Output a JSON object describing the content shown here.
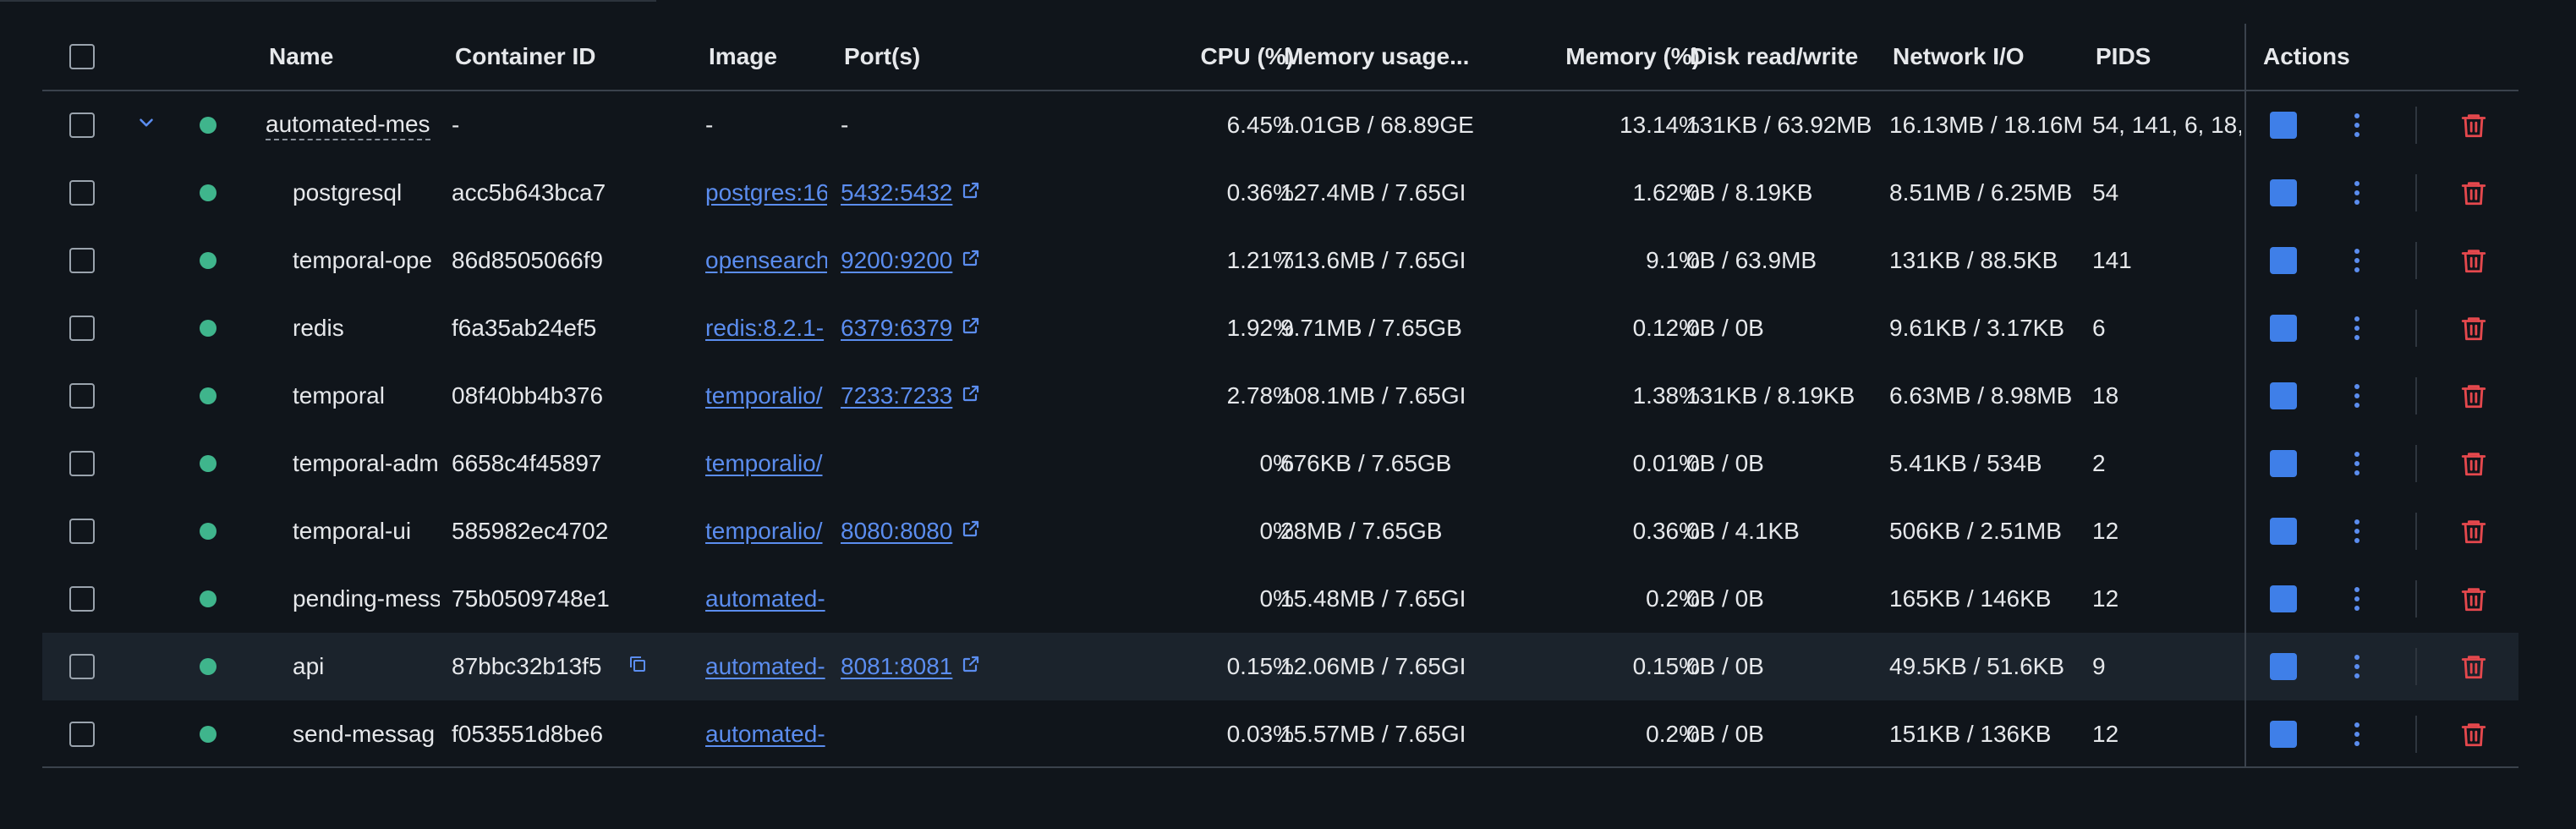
{
  "columns": {
    "name": "Name",
    "container_id": "Container ID",
    "image": "Image",
    "ports": "Port(s)",
    "cpu": "CPU (%)",
    "mem_usage": "Memory usage...",
    "mem_pct": "Memory (%)",
    "disk": "Disk read/write",
    "net": "Network I/O",
    "pids": "PIDS",
    "actions": "Actions"
  },
  "rows": [
    {
      "name": "automated-mes",
      "id": "-",
      "image": "-",
      "port": "-",
      "cpu": "6.45%",
      "mem": "1.01GB / 68.89GE",
      "memp": "13.14%",
      "disk": "131KB / 63.92MB",
      "net": "16.13MB / 18.16M",
      "pids": "54, 141, 6, 18,"
    },
    {
      "name": "postgresql",
      "id": "acc5b643bca7",
      "image": "postgres:16",
      "port": "5432:5432",
      "cpu": "0.36%",
      "mem": "127.4MB / 7.65GI",
      "memp": "1.62%",
      "disk": "0B / 8.19KB",
      "net": "8.51MB / 6.25MB",
      "pids": "54"
    },
    {
      "name": "temporal-ope",
      "id": "86d8505066f9",
      "image": "opensearch",
      "port": "9200:9200",
      "cpu": "1.21%",
      "mem": "713.6MB / 7.65GI",
      "memp": "9.1%",
      "disk": "0B / 63.9MB",
      "net": "131KB / 88.5KB",
      "pids": "141"
    },
    {
      "name": "redis",
      "id": "f6a35ab24ef5",
      "image": "redis:8.2.1-",
      "port": "6379:6379",
      "cpu": "1.92%",
      "mem": "9.71MB / 7.65GB",
      "memp": "0.12%",
      "disk": "0B / 0B",
      "net": "9.61KB / 3.17KB",
      "pids": "6"
    },
    {
      "name": "temporal",
      "id": "08f40bb4b376",
      "image": "temporalio/",
      "port": "7233:7233",
      "cpu": "2.78%",
      "mem": "108.1MB / 7.65GI",
      "memp": "1.38%",
      "disk": "131KB / 8.19KB",
      "net": "6.63MB / 8.98MB",
      "pids": "18"
    },
    {
      "name": "temporal-adm",
      "id": "6658c4f45897",
      "image": "temporalio/",
      "port": "",
      "cpu": "0%",
      "mem": "676KB / 7.65GB",
      "memp": "0.01%",
      "disk": "0B / 0B",
      "net": "5.41KB / 534B",
      "pids": "2"
    },
    {
      "name": "temporal-ui",
      "id": "585982ec4702",
      "image": "temporalio/",
      "port": "8080:8080",
      "cpu": "0%",
      "mem": "28MB / 7.65GB",
      "memp": "0.36%",
      "disk": "0B / 4.1KB",
      "net": "506KB / 2.51MB",
      "pids": "12"
    },
    {
      "name": "pending-mess",
      "id": "75b0509748e1",
      "image": "automated-",
      "port": "",
      "cpu": "0%",
      "mem": "15.48MB / 7.65GI",
      "memp": "0.2%",
      "disk": "0B / 0B",
      "net": "165KB / 146KB",
      "pids": "12"
    },
    {
      "name": "api",
      "id": "87bbc32b13f5",
      "image": "automated-",
      "port": "8081:8081",
      "cpu": "0.15%",
      "mem": "12.06MB / 7.65GI",
      "memp": "0.15%",
      "disk": "0B / 0B",
      "net": "49.5KB / 51.6KB",
      "pids": "9"
    },
    {
      "name": "send-messag",
      "id": "f053551d8be6",
      "image": "automated-",
      "port": "",
      "cpu": "0.03%",
      "mem": "15.57MB / 7.65GI",
      "memp": "0.2%",
      "disk": "0B / 0B",
      "net": "151KB / 136KB",
      "pids": "12"
    }
  ],
  "colors": {
    "running": "#3fb58c",
    "accent": "#3f7fe8",
    "link": "#5b8def",
    "delete": "#e5484d"
  }
}
